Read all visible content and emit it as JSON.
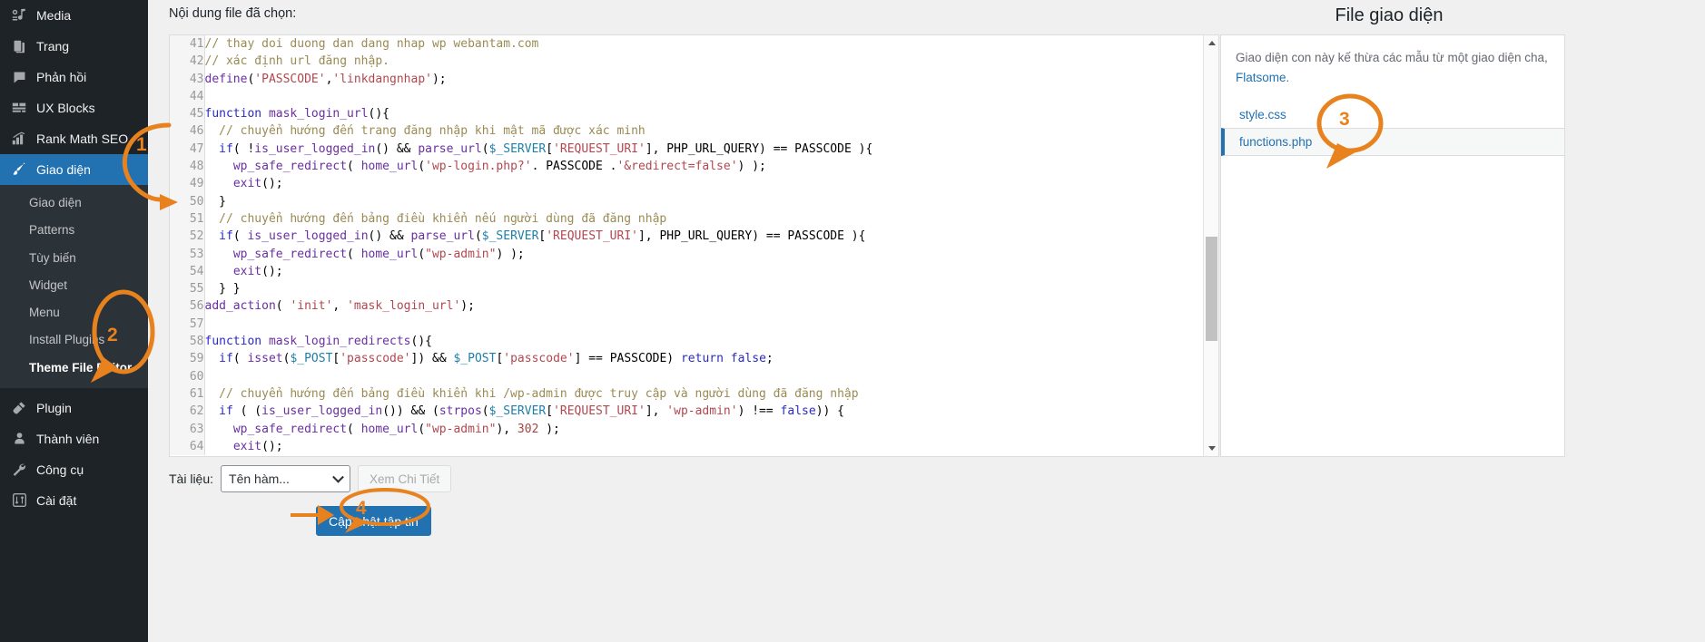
{
  "sidebar": {
    "items": [
      {
        "label": "Media",
        "icon": "media-icon",
        "active": false
      },
      {
        "label": "Trang",
        "icon": "pages-icon",
        "active": false
      },
      {
        "label": "Phản hồi",
        "icon": "comments-icon",
        "active": false
      },
      {
        "label": "UX Blocks",
        "icon": "blocks-icon",
        "active": false
      },
      {
        "label": "Rank Math SEO",
        "icon": "seo-chart-icon",
        "active": false
      },
      {
        "label": "Giao diện",
        "icon": "appearance-brush-icon",
        "active": true
      }
    ],
    "submenu": [
      {
        "label": "Giao diện",
        "current": false
      },
      {
        "label": "Patterns",
        "current": false
      },
      {
        "label": "Tùy biến",
        "current": false
      },
      {
        "label": "Widget",
        "current": false
      },
      {
        "label": "Menu",
        "current": false
      },
      {
        "label": "Install Plugins",
        "current": false
      },
      {
        "label": "Theme File Editor",
        "current": true
      }
    ],
    "items_after": [
      {
        "label": "Plugin",
        "icon": "plugin-icon"
      },
      {
        "label": "Thành viên",
        "icon": "users-icon"
      },
      {
        "label": "Công cụ",
        "icon": "tools-wrench-icon"
      },
      {
        "label": "Cài đặt",
        "icon": "settings-sliders-icon"
      }
    ]
  },
  "main": {
    "content_label": "Nội dung file đã chọn:",
    "file_panel_title": "File giao diện"
  },
  "editor": {
    "first_line_number": 41,
    "lines": [
      {
        "n": 41,
        "tokens": [
          {
            "t": "// thay doi duong dan dang nhap wp webantam.com",
            "c": "c"
          }
        ]
      },
      {
        "n": 42,
        "tokens": [
          {
            "t": "// xác định url đăng nhập.",
            "c": "c"
          }
        ]
      },
      {
        "n": 43,
        "tokens": [
          {
            "t": "define",
            "c": "fn"
          },
          {
            "t": "(",
            "c": "op"
          },
          {
            "t": "'PASSCODE'",
            "c": "st"
          },
          {
            "t": ",",
            "c": "op"
          },
          {
            "t": "'linkdangnhap'",
            "c": "st"
          },
          {
            "t": ");",
            "c": "op"
          }
        ]
      },
      {
        "n": 44,
        "tokens": []
      },
      {
        "n": 45,
        "tokens": [
          {
            "t": "function ",
            "c": "kw"
          },
          {
            "t": "mask_login_url",
            "c": "fn"
          },
          {
            "t": "(){",
            "c": "op"
          }
        ]
      },
      {
        "n": 46,
        "tokens": [
          {
            "t": "  // chuyển hướng đến trang đăng nhập khi mật mã được xác minh",
            "c": "c"
          }
        ]
      },
      {
        "n": 47,
        "tokens": [
          {
            "t": "  ",
            "c": "op"
          },
          {
            "t": "if",
            "c": "kw"
          },
          {
            "t": "( !",
            "c": "op"
          },
          {
            "t": "is_user_logged_in",
            "c": "fn"
          },
          {
            "t": "() && ",
            "c": "op"
          },
          {
            "t": "parse_url",
            "c": "fn"
          },
          {
            "t": "(",
            "c": "op"
          },
          {
            "t": "$_SERVER",
            "c": "vr"
          },
          {
            "t": "[",
            "c": "op"
          },
          {
            "t": "'REQUEST_URI'",
            "c": "st"
          },
          {
            "t": "], PHP_URL_QUERY) == PASSCODE ){",
            "c": "op"
          }
        ]
      },
      {
        "n": 48,
        "tokens": [
          {
            "t": "    ",
            "c": "op"
          },
          {
            "t": "wp_safe_redirect",
            "c": "fn"
          },
          {
            "t": "( ",
            "c": "op"
          },
          {
            "t": "home_url",
            "c": "fn"
          },
          {
            "t": "(",
            "c": "op"
          },
          {
            "t": "'wp-login.php?'",
            "c": "st"
          },
          {
            "t": ". PASSCODE .",
            "c": "op"
          },
          {
            "t": "'&redirect=false'",
            "c": "st"
          },
          {
            "t": ") );",
            "c": "op"
          }
        ]
      },
      {
        "n": 49,
        "tokens": [
          {
            "t": "    ",
            "c": "op"
          },
          {
            "t": "exit",
            "c": "fn"
          },
          {
            "t": "();",
            "c": "op"
          }
        ]
      },
      {
        "n": 50,
        "tokens": [
          {
            "t": "  }",
            "c": "op"
          }
        ]
      },
      {
        "n": 51,
        "tokens": [
          {
            "t": "  // chuyển hướng đến bảng điều khiển nếu người dùng đã đăng nhập",
            "c": "c"
          }
        ]
      },
      {
        "n": 52,
        "tokens": [
          {
            "t": "  ",
            "c": "op"
          },
          {
            "t": "if",
            "c": "kw"
          },
          {
            "t": "( ",
            "c": "op"
          },
          {
            "t": "is_user_logged_in",
            "c": "fn"
          },
          {
            "t": "() && ",
            "c": "op"
          },
          {
            "t": "parse_url",
            "c": "fn"
          },
          {
            "t": "(",
            "c": "op"
          },
          {
            "t": "$_SERVER",
            "c": "vr"
          },
          {
            "t": "[",
            "c": "op"
          },
          {
            "t": "'REQUEST_URI'",
            "c": "st"
          },
          {
            "t": "], PHP_URL_QUERY) == PASSCODE ){",
            "c": "op"
          }
        ]
      },
      {
        "n": 53,
        "tokens": [
          {
            "t": "    ",
            "c": "op"
          },
          {
            "t": "wp_safe_redirect",
            "c": "fn"
          },
          {
            "t": "( ",
            "c": "op"
          },
          {
            "t": "home_url",
            "c": "fn"
          },
          {
            "t": "(",
            "c": "op"
          },
          {
            "t": "\"wp-admin\"",
            "c": "st"
          },
          {
            "t": ") );",
            "c": "op"
          }
        ]
      },
      {
        "n": 54,
        "tokens": [
          {
            "t": "    ",
            "c": "op"
          },
          {
            "t": "exit",
            "c": "fn"
          },
          {
            "t": "();",
            "c": "op"
          }
        ]
      },
      {
        "n": 55,
        "tokens": [
          {
            "t": "  } }",
            "c": "op"
          }
        ]
      },
      {
        "n": 56,
        "tokens": [
          {
            "t": "add_action",
            "c": "fn"
          },
          {
            "t": "( ",
            "c": "op"
          },
          {
            "t": "'init'",
            "c": "st"
          },
          {
            "t": ", ",
            "c": "op"
          },
          {
            "t": "'mask_login_url'",
            "c": "st"
          },
          {
            "t": ");",
            "c": "op"
          }
        ]
      },
      {
        "n": 57,
        "tokens": []
      },
      {
        "n": 58,
        "tokens": [
          {
            "t": "function ",
            "c": "kw"
          },
          {
            "t": "mask_login_redirects",
            "c": "fn"
          },
          {
            "t": "(){",
            "c": "op"
          }
        ]
      },
      {
        "n": 59,
        "tokens": [
          {
            "t": "  ",
            "c": "op"
          },
          {
            "t": "if",
            "c": "kw"
          },
          {
            "t": "( ",
            "c": "op"
          },
          {
            "t": "isset",
            "c": "fn"
          },
          {
            "t": "(",
            "c": "op"
          },
          {
            "t": "$_POST",
            "c": "vr"
          },
          {
            "t": "[",
            "c": "op"
          },
          {
            "t": "'passcode'",
            "c": "st"
          },
          {
            "t": "]) && ",
            "c": "op"
          },
          {
            "t": "$_POST",
            "c": "vr"
          },
          {
            "t": "[",
            "c": "op"
          },
          {
            "t": "'passcode'",
            "c": "st"
          },
          {
            "t": "] == PASSCODE) ",
            "c": "op"
          },
          {
            "t": "return ",
            "c": "kw"
          },
          {
            "t": "false",
            "c": "kw"
          },
          {
            "t": ";",
            "c": "op"
          }
        ]
      },
      {
        "n": 60,
        "tokens": []
      },
      {
        "n": 61,
        "tokens": [
          {
            "t": "  // chuyển hướng đến bảng điều khiển khi /wp-admin được truy cập và người dùng đã đăng nhập",
            "c": "c"
          }
        ]
      },
      {
        "n": 62,
        "tokens": [
          {
            "t": "  ",
            "c": "op"
          },
          {
            "t": "if",
            "c": "kw"
          },
          {
            "t": " ( (",
            "c": "op"
          },
          {
            "t": "is_user_logged_in",
            "c": "fn"
          },
          {
            "t": "()) && (",
            "c": "op"
          },
          {
            "t": "strpos",
            "c": "fn"
          },
          {
            "t": "(",
            "c": "op"
          },
          {
            "t": "$_SERVER",
            "c": "vr"
          },
          {
            "t": "[",
            "c": "op"
          },
          {
            "t": "'REQUEST_URI'",
            "c": "st"
          },
          {
            "t": "], ",
            "c": "op"
          },
          {
            "t": "'wp-admin'",
            "c": "st"
          },
          {
            "t": ") !== ",
            "c": "op"
          },
          {
            "t": "false",
            "c": "kw"
          },
          {
            "t": ")) {",
            "c": "op"
          }
        ]
      },
      {
        "n": 63,
        "tokens": [
          {
            "t": "    ",
            "c": "op"
          },
          {
            "t": "wp_safe_redirect",
            "c": "fn"
          },
          {
            "t": "( ",
            "c": "op"
          },
          {
            "t": "home_url",
            "c": "fn"
          },
          {
            "t": "(",
            "c": "op"
          },
          {
            "t": "\"wp-admin\"",
            "c": "st"
          },
          {
            "t": "), ",
            "c": "op"
          },
          {
            "t": "302",
            "c": "nm"
          },
          {
            "t": " );",
            "c": "op"
          }
        ]
      },
      {
        "n": 64,
        "tokens": [
          {
            "t": "    ",
            "c": "op"
          },
          {
            "t": "exit",
            "c": "fn"
          },
          {
            "t": "();",
            "c": "op"
          }
        ]
      }
    ]
  },
  "footer": {
    "docs_label": "Tài liệu:",
    "docs_select_value": "Tên hàm...",
    "lookup_button": "Xem Chi Tiết",
    "update_button": "Cập nhật tập tin"
  },
  "file_panel": {
    "note_prefix": "Giao diện con này kế thừa các mẫu từ một giao diện cha, ",
    "parent_theme": "Flatsome",
    "note_suffix": ".",
    "files": [
      {
        "name": "style.css",
        "selected": false
      },
      {
        "name": "functions.php",
        "selected": true
      }
    ]
  },
  "annotations": {
    "accent_color": "#e8821e",
    "markers": [
      {
        "id": "1",
        "label": "1",
        "target": "sidebar-item-giao-dien"
      },
      {
        "id": "2",
        "label": "2",
        "target": "submenu-theme-file-editor"
      },
      {
        "id": "3",
        "label": "3",
        "target": "file-item-functions-php"
      },
      {
        "id": "4",
        "label": "4",
        "target": "update-file-button"
      }
    ]
  }
}
